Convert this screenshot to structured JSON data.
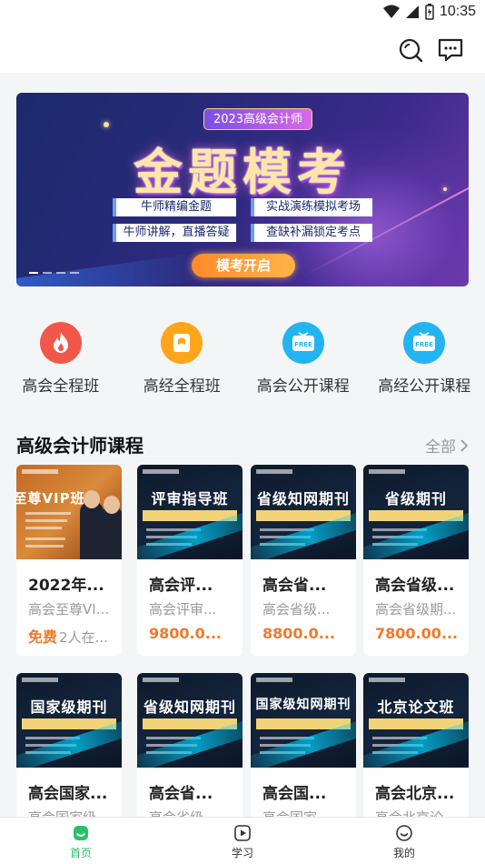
{
  "status_bar": {
    "time": "10:35"
  },
  "banner": {
    "pill": "2023高级会计师",
    "title": "金题模考",
    "tags": [
      "牛师精编金题",
      "实战演练模拟考场",
      "牛师讲解，直播答疑",
      "查缺补漏锁定考点"
    ],
    "button": "模考开启"
  },
  "quick_nav": [
    {
      "label": "高会全程班",
      "icon": "fire-icon",
      "color": "#f2574a"
    },
    {
      "label": "高经全程班",
      "icon": "notebook-icon",
      "color": "#ffa51c"
    },
    {
      "label": "高会公开课程",
      "icon": "free-tv-icon",
      "color": "#23b4f2",
      "badge": "FREE"
    },
    {
      "label": "高经公开课程",
      "icon": "free-tv-icon",
      "color": "#23b4f2",
      "badge": "FREE"
    }
  ],
  "section": {
    "title": "高级会计师课程",
    "more": "全部"
  },
  "courses": [
    {
      "thumb": "至尊VIP班",
      "title": "2022年...",
      "subtitle": "高会至尊VI...",
      "price": "免费",
      "count": "2人在..."
    },
    {
      "thumb": "评审指导班",
      "title": "高会评...",
      "subtitle": "高会评审...",
      "price": "9800.0...",
      "count": ""
    },
    {
      "thumb": "省级知网期刊",
      "title": "高会省...",
      "subtitle": "高会省级...",
      "price": "8800.0...",
      "count": ""
    },
    {
      "thumb": "省级期刊",
      "title": "高会省级...",
      "subtitle": "高会省级期...",
      "price": "7800.00...",
      "count": ""
    },
    {
      "thumb": "国家级期刊",
      "title": "高会国家...",
      "subtitle": "高会国家级...",
      "price": "",
      "count": ""
    },
    {
      "thumb": "省级知网期刊",
      "title": "高会省...",
      "subtitle": "高会省级...",
      "price": "",
      "count": ""
    },
    {
      "thumb": "国家级知网期刊",
      "title": "高会国...",
      "subtitle": "高会国家...",
      "price": "",
      "count": ""
    },
    {
      "thumb": "北京论文班",
      "title": "高会北京...",
      "subtitle": "高会北京论...",
      "price": "",
      "count": ""
    }
  ],
  "tabs": [
    {
      "label": "首页",
      "icon": "home-icon",
      "active": true
    },
    {
      "label": "学习",
      "icon": "play-icon",
      "active": false
    },
    {
      "label": "我的",
      "icon": "smile-icon",
      "active": false
    }
  ],
  "colors": {
    "accent": "#2bbf6a",
    "price": "#f07a2a"
  }
}
